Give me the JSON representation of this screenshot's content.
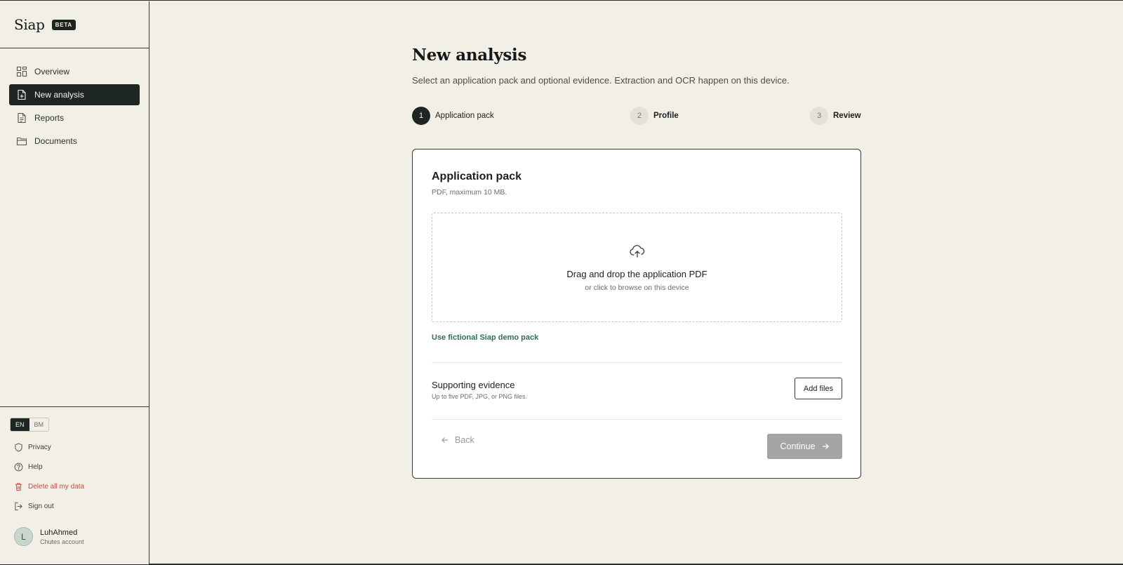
{
  "brand": {
    "name": "Siap",
    "badge": "BETA"
  },
  "nav": [
    {
      "label": "Overview",
      "icon": "grid-icon"
    },
    {
      "label": "New analysis",
      "icon": "file-plus-icon",
      "active": true
    },
    {
      "label": "Reports",
      "icon": "file-text-icon"
    },
    {
      "label": "Documents",
      "icon": "folder-icon"
    }
  ],
  "language": {
    "options": [
      "EN",
      "BM"
    ],
    "selected": "EN"
  },
  "utility": {
    "privacy": "Privacy",
    "help": "Help",
    "delete": "Delete all my data",
    "signout": "Sign out"
  },
  "user": {
    "initial": "L",
    "name": "LuhAhmed",
    "account": "Chutes account"
  },
  "page": {
    "title": "New analysis",
    "subtitle": "Select an application pack and optional evidence. Extraction and OCR happen on this device."
  },
  "steps": [
    {
      "num": "1",
      "label": "Application pack",
      "current": true
    },
    {
      "num": "2",
      "label": "Profile"
    },
    {
      "num": "3",
      "label": "Review"
    }
  ],
  "card": {
    "title": "Application pack",
    "subtitle": "PDF, maximum 10 MB.",
    "dropzone": {
      "title": "Drag and drop the application PDF",
      "subtitle": "or click to browse on this device"
    },
    "demo_link": "Use fictional Siap demo pack",
    "evidence": {
      "title": "Supporting evidence",
      "subtitle": "Up to five PDF, JPG, or PNG files.",
      "button": "Add files"
    },
    "back": "Back",
    "continue": "Continue"
  },
  "colors": {
    "background": "#f2efe7",
    "accent_dark": "#1d2622",
    "link": "#2f6b63",
    "danger": "#c94d3f",
    "disabled_button": "#a3a5a2"
  }
}
